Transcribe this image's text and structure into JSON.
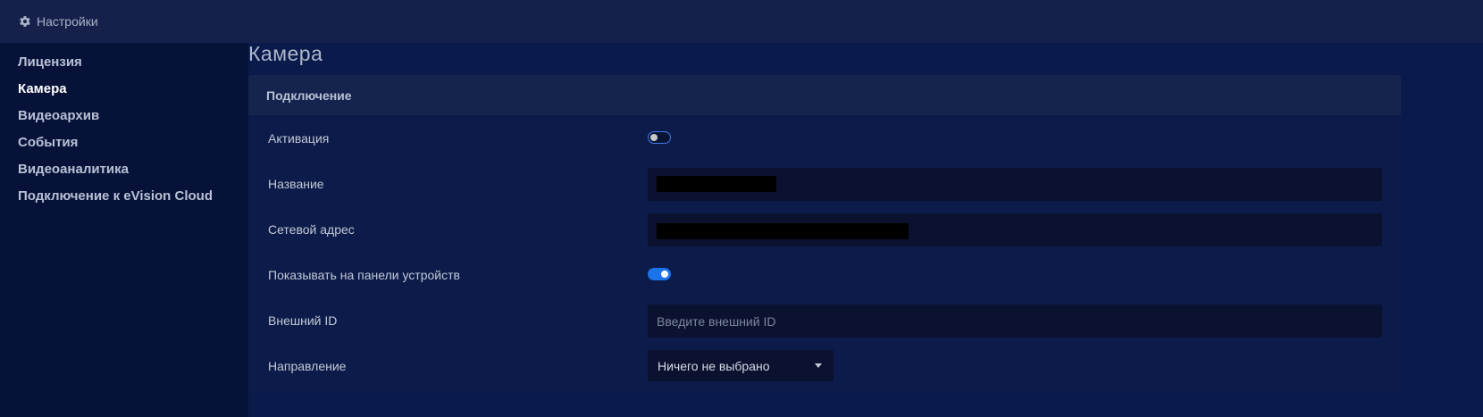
{
  "header": {
    "title": "Настройки",
    "icon": "gear-icon"
  },
  "sidebar": {
    "items": [
      {
        "label": "Лицензия",
        "active": false
      },
      {
        "label": "Камера",
        "active": true
      },
      {
        "label": "Видеоархив",
        "active": false
      },
      {
        "label": "События",
        "active": false
      },
      {
        "label": "Видеоаналитика",
        "active": false
      },
      {
        "label": "Подключение к eVision Cloud",
        "active": false
      }
    ]
  },
  "main": {
    "title": "Камера",
    "section": {
      "header": "Подключение",
      "fields": {
        "activation": {
          "label": "Активация",
          "enabled": false
        },
        "name": {
          "label": "Название",
          "value": ""
        },
        "network_address": {
          "label": "Сетевой адрес",
          "value": ""
        },
        "show_on_device_panel": {
          "label": "Показывать на панели устройств",
          "enabled": true
        },
        "external_id": {
          "label": "Внешний ID",
          "value": "",
          "placeholder": "Введите внешний ID"
        },
        "direction": {
          "label": "Направление",
          "selected": "Ничего не выбрано"
        }
      }
    }
  },
  "colors": {
    "accent": "#1a73e8",
    "background": "#071238",
    "panel": "#0c1b49",
    "header": "#15214a"
  }
}
